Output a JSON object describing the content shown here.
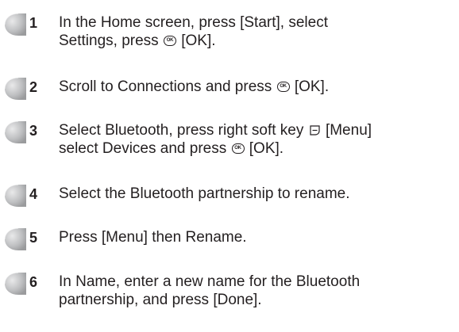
{
  "ok_icon_text": "OK",
  "steps": [
    {
      "number": "1",
      "lines": [
        [
          "In the Home screen, press [Start], select"
        ],
        [
          "Settings, press ",
          "ok-icon",
          " [OK]."
        ]
      ]
    },
    {
      "number": "2",
      "lines": [
        [
          "Scroll to Connections and press ",
          "ok-icon",
          " [OK]."
        ]
      ]
    },
    {
      "number": "3",
      "lines": [
        [
          "Select Bluetooth, press right soft key ",
          "softkey-icon",
          " [Menu]"
        ],
        [
          "select Devices and press ",
          "ok-icon",
          " [OK]."
        ]
      ]
    },
    {
      "number": "4",
      "lines": [
        [
          "Select the Bluetooth partnership to rename."
        ]
      ]
    },
    {
      "number": "5",
      "lines": [
        [
          "Press [Menu] then Rename."
        ]
      ]
    },
    {
      "number": "6",
      "lines": [
        [
          "In Name, enter a new name for the Bluetooth"
        ],
        [
          "partnership, and press [Done]."
        ]
      ]
    }
  ]
}
